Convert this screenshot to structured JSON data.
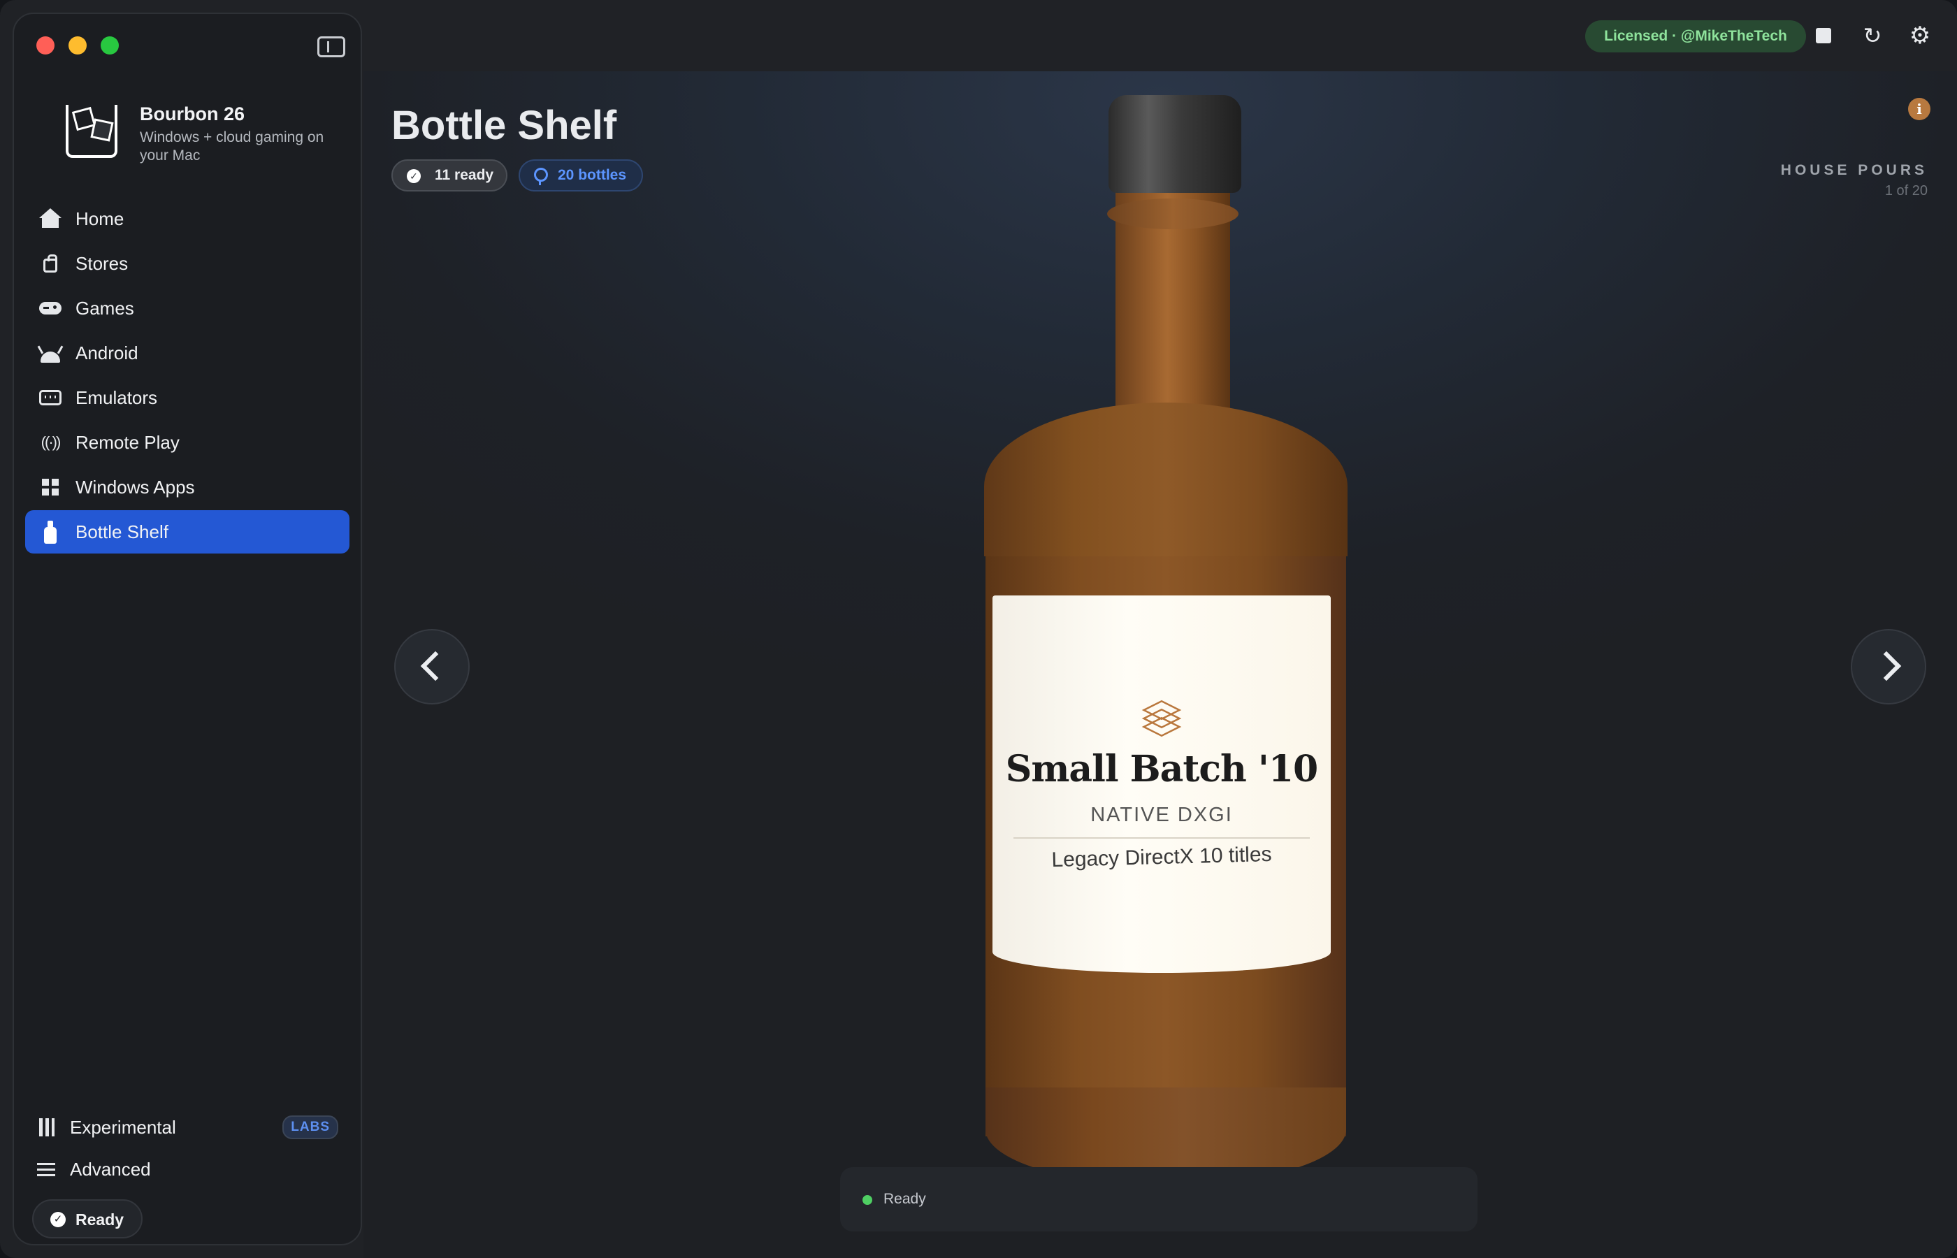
{
  "window": {
    "traffic_lights": [
      "close",
      "minimize",
      "maximize"
    ]
  },
  "sidebar": {
    "brand": {
      "title": "Bourbon 26",
      "subtitle": "Windows + cloud gaming on your Mac"
    },
    "items": [
      {
        "label": "Home",
        "icon": "home-icon",
        "active": false
      },
      {
        "label": "Stores",
        "icon": "bag-icon",
        "active": false
      },
      {
        "label": "Games",
        "icon": "gamepad-icon",
        "active": false
      },
      {
        "label": "Android",
        "icon": "android-icon",
        "active": false
      },
      {
        "label": "Emulators",
        "icon": "keyboard-icon",
        "active": false
      },
      {
        "label": "Remote Play",
        "icon": "broadcast-icon",
        "active": false
      },
      {
        "label": "Windows Apps",
        "icon": "grid-icon",
        "active": false
      },
      {
        "label": "Bottle Shelf",
        "icon": "bottle-icon",
        "active": true
      }
    ],
    "bottom": {
      "experimental": {
        "label": "Experimental",
        "badge": "LABS"
      },
      "advanced": {
        "label": "Advanced"
      }
    },
    "status": {
      "label": "Ready"
    }
  },
  "topbar": {
    "license": "Licensed · @MikeTheTech"
  },
  "main": {
    "title": "Bottle Shelf",
    "chips": {
      "ready": "11 ready",
      "bottles": "20 bottles"
    },
    "collection": {
      "name": "HOUSE POURS",
      "position": "1 of 20"
    },
    "bottle": {
      "name": "Small Batch '10",
      "type": "NATIVE DXGI",
      "description": "Legacy DirectX 10 titles",
      "label_icon": "layers-icon"
    },
    "status": {
      "text": "Ready",
      "color": "#4fcf63"
    }
  },
  "colors": {
    "accent": "#2458d4",
    "license_bg": "#284a32",
    "license_text": "#8fe39c",
    "bottle_amber": "#8c5727",
    "info": "#b8793f"
  }
}
